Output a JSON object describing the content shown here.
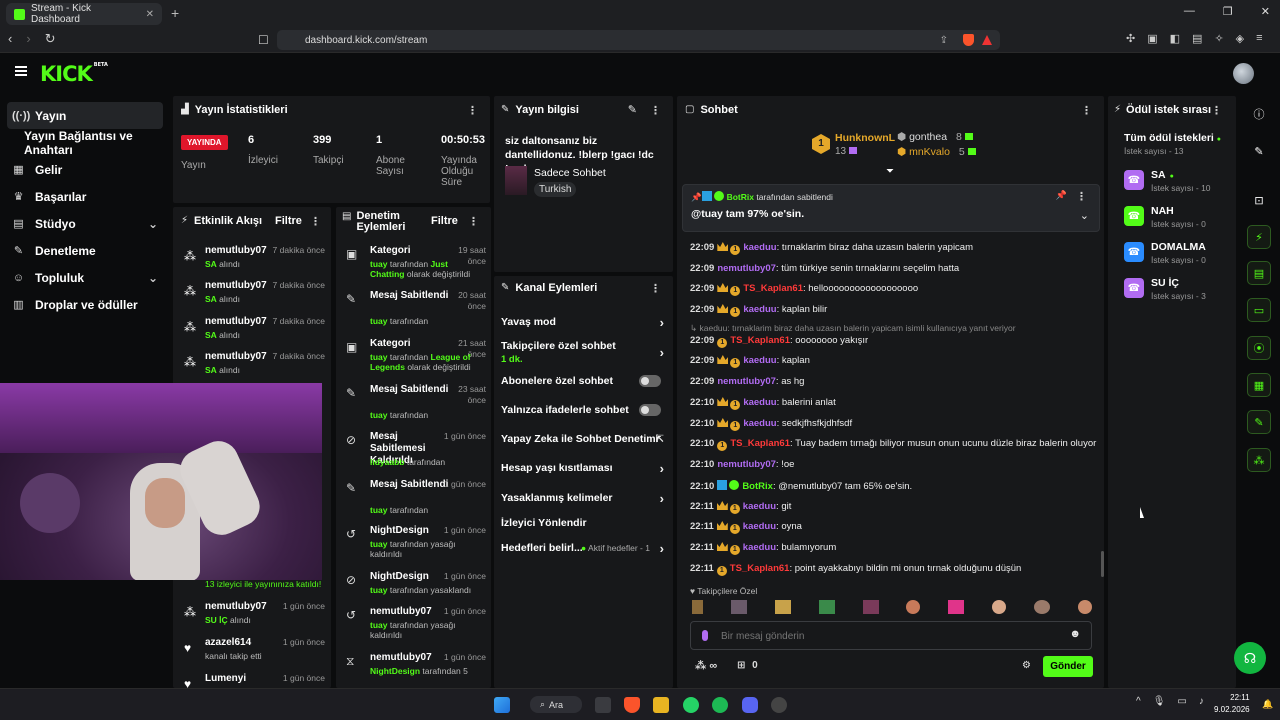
{
  "browser": {
    "tab_title": "Stream - Kick Dashboard",
    "tab_close": "✕",
    "new_tab": "+",
    "url": "dashboard.kick.com/stream",
    "window_controls": [
      "—",
      "❐",
      "✕"
    ]
  },
  "header": {
    "logo": "KICK",
    "logo_badge": "BETA"
  },
  "sidebar": {
    "items": [
      {
        "label": "Yayın",
        "icon": "broadcast-icon"
      },
      {
        "label": "Yayın Bağlantısı ve Anahtarı"
      },
      {
        "label": "Gelir",
        "icon": "revenue-icon"
      },
      {
        "label": "Başarılar",
        "icon": "trophy-icon"
      },
      {
        "label": "Stüdyo",
        "icon": "studio-icon"
      },
      {
        "label": "Denetleme",
        "icon": "wrench-icon"
      },
      {
        "label": "Topluluk",
        "icon": "community-icon"
      },
      {
        "label": "Droplar ve ödüller",
        "icon": "drops-icon"
      }
    ]
  },
  "stats": {
    "title": "Yayın İstatistikleri",
    "live_label": "YAYINDA",
    "live_caption": "Yayın",
    "columns": [
      {
        "value": "6",
        "label": "İzleyici"
      },
      {
        "value": "399",
        "label": "Takipçi"
      },
      {
        "value": "1",
        "label": "Abone Sayısı"
      },
      {
        "value": "00:50:53",
        "label": "Yayında Olduğu Süre"
      }
    ]
  },
  "activity": {
    "title": "Etkinlik Akışı",
    "filter": "Filtre",
    "rows": [
      {
        "user": "nemutluby07",
        "time": "7 dakika önce",
        "highlight": "SA",
        "text": " alındı",
        "icon": "gift-icon"
      },
      {
        "user": "nemutluby07",
        "time": "7 dakika önce",
        "highlight": "SA",
        "text": " alındı",
        "icon": "gift-icon"
      },
      {
        "user": "nemutluby07",
        "time": "7 dakika önce",
        "highlight": "SA",
        "text": " alındı",
        "icon": "gift-icon"
      },
      {
        "user": "nemutluby07",
        "time": "7 dakika önce",
        "highlight": "SA",
        "text": " alındı",
        "icon": "gift-icon"
      }
    ],
    "viewer_note": "13 izleyici ile yayınınıza katıldı!",
    "rows_bottom": [
      {
        "user": "nemutluby07",
        "time": "1 gün önce",
        "highlight": "SU İÇ",
        "text": " alındı",
        "icon": "gift-icon"
      },
      {
        "user": "azazel614",
        "time": "1 gün önce",
        "highlight": "",
        "text": "kanalı takip etti",
        "icon": "heart-icon"
      },
      {
        "user": "Lumenyi",
        "time": "1 gün önce",
        "highlight": "",
        "text": "",
        "icon": "heart-icon"
      }
    ]
  },
  "moderation": {
    "title": "Denetim Eylemleri",
    "filter": "Filtre",
    "rows": [
      {
        "title": "Kategori",
        "time": "19 saat önce",
        "actor": "tuay",
        "mid": " tarafından ",
        "target": "Just Chatting",
        "tail": " olarak değiştirildi",
        "icon": "category-icon"
      },
      {
        "title": "Mesaj Sabitlendi",
        "time": "20 saat önce",
        "actor": "tuay",
        "mid": " tarafından",
        "target": "",
        "tail": "",
        "icon": "pin-icon"
      },
      {
        "title": "Kategori",
        "time": "21 saat önce",
        "actor": "tuay",
        "mid": " tarafından ",
        "target": "League of Legends",
        "tail": " olarak değiştirildi",
        "icon": "category-icon"
      },
      {
        "title": "Mesaj Sabitlendi",
        "time": "23 saat önce",
        "actor": "tuay",
        "mid": " tarafından",
        "target": "",
        "tail": "",
        "icon": "pin-icon"
      },
      {
        "title": "Mesaj Sabitlemesi Kaldırıldı",
        "time": "1 gün önce",
        "actor": "lidyaabb",
        "mid": " tarafından",
        "target": "",
        "tail": "",
        "icon": "unpin-icon"
      },
      {
        "title": "Mesaj Sabitlendi",
        "time": "1 gün önce",
        "actor": "tuay",
        "mid": " tarafından",
        "target": "",
        "tail": "",
        "icon": "pin-icon"
      },
      {
        "title": "NightDesign",
        "time": "1 gün önce",
        "actor": "tuay",
        "mid": " tarafından yasağı kaldırıldı",
        "target": "",
        "tail": "",
        "icon": "undo-icon"
      },
      {
        "title": "NightDesign",
        "time": "1 gün önce",
        "actor": "tuay",
        "mid": " tarafından yasaklandı",
        "target": "",
        "tail": "",
        "icon": "ban-icon"
      },
      {
        "title": "nemutluby07",
        "time": "1 gün önce",
        "actor": "tuay",
        "mid": " tarafından yasağı kaldırıldı",
        "target": "",
        "tail": "",
        "icon": "undo-icon"
      },
      {
        "title": "nemutluby07",
        "time": "1 gün önce",
        "actor": "NightDesign",
        "mid": " tarafından 5",
        "target": "",
        "tail": "",
        "icon": "timeout-icon"
      }
    ]
  },
  "stream_info": {
    "title": "Yayın bilgisi",
    "stream_title": "siz daltonsanız biz dantellidonuz. !blerp !gacı !dc !mal",
    "category": "Sadece Sohbet",
    "language": "Turkish"
  },
  "channel_actions": {
    "title": "Kanal Eylemleri",
    "slow_mode": "Yavaş mod",
    "followers_only": "Takipçilere özel sohbet",
    "followers_only_value": "1 dk.",
    "subs_only": "Abonelere özel sohbet",
    "subs_only_on": false,
    "emotes_only": "Yalnızca ifadelerle sohbet",
    "emotes_only_on": false,
    "ai_moderation": "Yapay Zeka ile Sohbet Denetimi",
    "account_age": "Hesap yaşı kısıtlaması",
    "banned_words": "Yasaklanmış kelimeler",
    "redirect": "İzleyici Yönlendir",
    "goals": "Hedefleri belirl...",
    "goals_status": "Aktif hedefler - 1"
  },
  "chat": {
    "title": "Sohbet",
    "top_gifters": [
      {
        "name": "HunknownL",
        "count": "13"
      },
      {
        "name": "gonthea",
        "count": "8"
      },
      {
        "name": "mnKvalo",
        "count": "5"
      }
    ],
    "rank_badge": "1",
    "pinned_by_user": "BotRix",
    "pinned_by_suffix": " tarafından sabitlendi",
    "pinned_text": "@tuay tam 97% oe'sin.",
    "messages": [
      {
        "time": "22:09",
        "user": "kaeduu",
        "color": "#b16cf2",
        "badges": "crown-coin",
        "text": ": tırnaklarim biraz daha uzasın balerin yapicam"
      },
      {
        "time": "22:09",
        "user": "nemutluby07",
        "color": "#b16cf2",
        "badges": "",
        "text": ": tüm türkiye senin tırnaklarını seçelim hatta"
      },
      {
        "time": "22:09",
        "user": "TS_Kaplan61",
        "color": "#ff3a3a",
        "badges": "crown-coin",
        "text": ": helloooooooooooooooooo"
      },
      {
        "time": "22:09",
        "user": "kaeduu",
        "color": "#b16cf2",
        "badges": "crown-coin",
        "text": ": kaplan bilir"
      },
      {
        "time": "22:09",
        "user": "TS_Kaplan61",
        "color": "#ff3a3a",
        "badges": "coin",
        "text": ": oooooooo yakışır"
      },
      {
        "time": "22:09",
        "user": "kaeduu",
        "color": "#b16cf2",
        "badges": "crown-coin",
        "text": ": kaplan"
      },
      {
        "time": "22:09",
        "user": "nemutluby07",
        "color": "#b16cf2",
        "badges": "",
        "text": ": as hg"
      },
      {
        "time": "22:10",
        "user": "kaeduu",
        "color": "#b16cf2",
        "badges": "crown-coin",
        "text": ": balerini anlat"
      },
      {
        "time": "22:10",
        "user": "kaeduu",
        "color": "#b16cf2",
        "badges": "crown-coin",
        "text": ": sedkjfhsfkjdhfsdf"
      },
      {
        "time": "22:10",
        "user": "TS_Kaplan61",
        "color": "#ff3a3a",
        "badges": "coin",
        "text": ": Tuay badem tırnağı biliyor musun onun ucunu düzle biraz balerin oluyor"
      },
      {
        "time": "22:10",
        "user": "nemutluby07",
        "color": "#b16cf2",
        "badges": "",
        "text": ": !oe"
      },
      {
        "time": "22:10",
        "user": "BotRix",
        "color": "#53fc18",
        "badges": "bot",
        "text": ": @nemutluby07 tam 65% oe'sin."
      },
      {
        "time": "22:11",
        "user": "kaeduu",
        "color": "#b16cf2",
        "badges": "crown-coin",
        "text": ": git"
      },
      {
        "time": "22:11",
        "user": "kaeduu",
        "color": "#b16cf2",
        "badges": "crown-coin",
        "text": ": oyna"
      },
      {
        "time": "22:11",
        "user": "kaeduu",
        "color": "#b16cf2",
        "badges": "crown-coin",
        "text": ": bulamıyorum"
      },
      {
        "time": "22:11",
        "user": "TS_Kaplan61",
        "color": "#ff3a3a",
        "badges": "coin",
        "text": ": point ayakkabıyı bildin mi onun tırnak olduğunu düşün"
      }
    ],
    "reply_note": "kaeduu: tırnaklarim biraz daha uzasın balerin yapicam isimli kullanıcıya yanıt veriyor",
    "followers_only_label": "Takipçilere Özel",
    "input_placeholder": "Bir mesaj gönderin",
    "points_value": "∞",
    "gift_count": "0",
    "send_label": "Gönder"
  },
  "rewards": {
    "title": "Ödül istek sırası",
    "all_requests": "Tüm ödül istekleri",
    "total_count": "İstek sayısı - 13",
    "items": [
      {
        "name": "SA",
        "count": "İstek sayısı - 10",
        "color": "#b16cf2",
        "active": true
      },
      {
        "name": "NAH",
        "count": "İstek sayısı - 0",
        "color": "#53fc18",
        "active": false
      },
      {
        "name": "DOMALMA",
        "count": "İstek sayısı - 0",
        "color": "#2a8cff",
        "active": false
      },
      {
        "name": "SU İÇ",
        "count": "İstek sayısı - 3",
        "color": "#b16cf2",
        "active": false
      }
    ]
  },
  "taskbar": {
    "search_label": "Ara",
    "time": "22:11",
    "date": "9.02.2026"
  }
}
